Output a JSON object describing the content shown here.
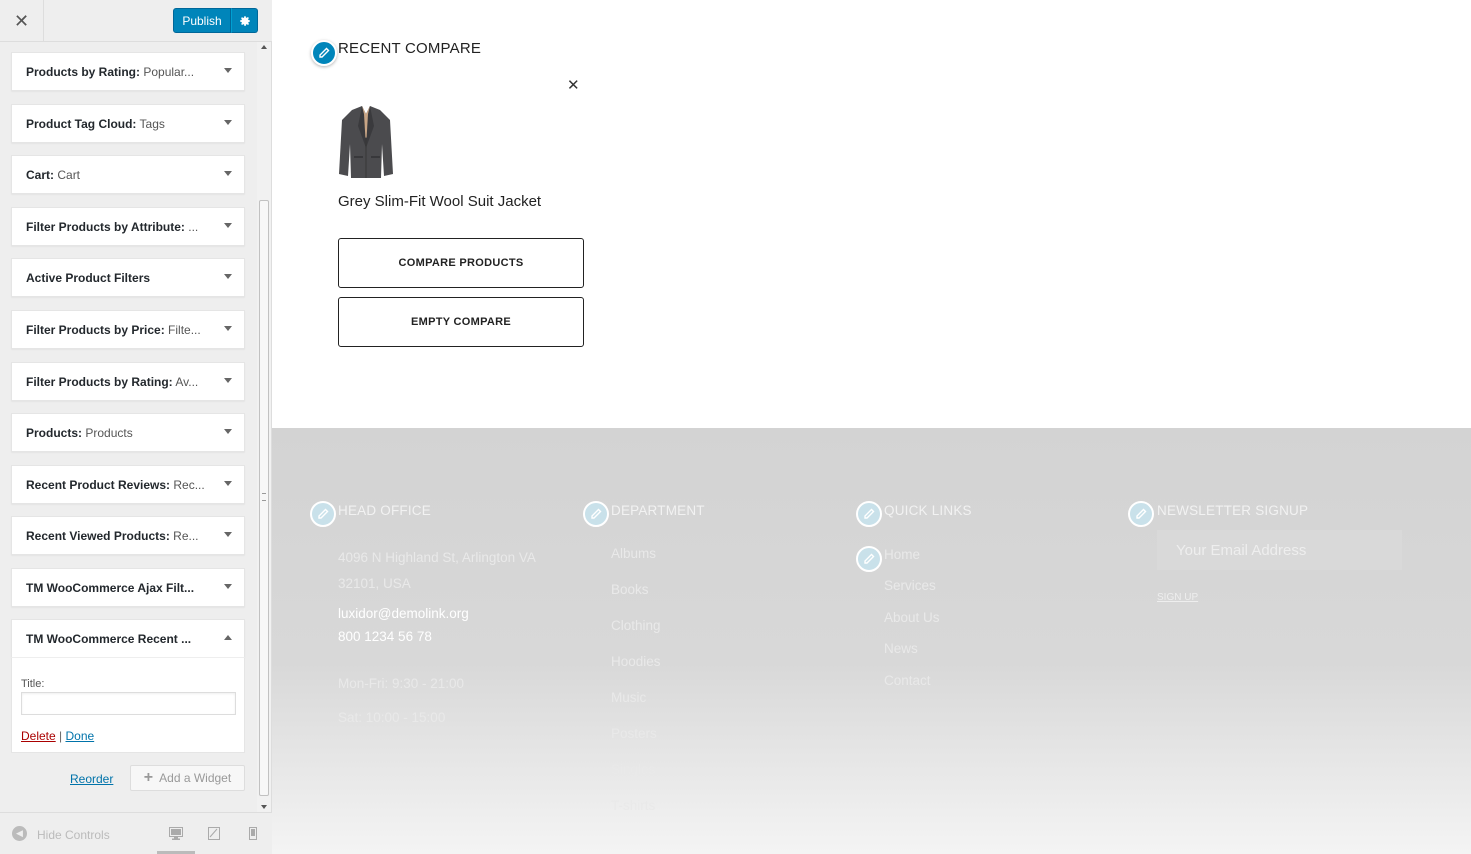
{
  "header": {
    "close_label": "✕",
    "publish_label": "Publish",
    "publish_settings_icon": "gear-icon"
  },
  "widgets": [
    {
      "name": "Products by Rating:",
      "subtitle": " Popular..."
    },
    {
      "name": "Product Tag Cloud:",
      "subtitle": " Tags"
    },
    {
      "name": "Cart:",
      "subtitle": " Cart"
    },
    {
      "name": "Filter Products by Attribute:",
      "subtitle": " ..."
    },
    {
      "name": "Active Product Filters",
      "subtitle": ""
    },
    {
      "name": "Filter Products by Price:",
      "subtitle": " Filte..."
    },
    {
      "name": "Filter Products by Rating:",
      "subtitle": " Av..."
    },
    {
      "name": "Products:",
      "subtitle": " Products"
    },
    {
      "name": "Recent Product Reviews:",
      "subtitle": " Rec..."
    },
    {
      "name": "Recent Viewed Products:",
      "subtitle": " Re..."
    },
    {
      "name": "TM WooCommerce Ajax Filt...",
      "subtitle": ""
    },
    {
      "name": "TM WooCommerce Recent ...",
      "subtitle": ""
    }
  ],
  "open_widget": {
    "title_label": "Title:",
    "title_value": "",
    "delete_label": "Delete",
    "separator": " | ",
    "done_label": "Done"
  },
  "widget_area": {
    "reorder_label": "Reorder",
    "add_widget_label": "Add a Widget"
  },
  "footer_controls": {
    "hide_controls_label": "Hide Controls"
  },
  "preview": {
    "compare": {
      "title": "RECENT COMPARE",
      "product_name": "Grey Slim-Fit Wool Suit Jacket",
      "compare_button": "COMPARE PRODUCTS",
      "empty_button": "EMPTY COMPARE"
    },
    "footer": {
      "head_office": {
        "title": "HEAD OFFICE",
        "address_line1": "4096 N Highland St, Arlington VA",
        "address_line2": "32101, USA",
        "email": "luxidor@demolink.org",
        "phone": "800 1234 56 78",
        "hours1": "Mon-Fri: 9:30 - 21:00",
        "hours2": "Sat: 10:00 - 15:00"
      },
      "department": {
        "title": "DEPARTMENT",
        "items": [
          "Albums",
          "Books",
          "Clothing",
          "Hoodies",
          "Music",
          "Posters",
          "Singles",
          "T-shirts"
        ]
      },
      "quick_links": {
        "title": "QUICK LINKS",
        "items": [
          "Home",
          "Services",
          "About Us",
          "News",
          "Contact"
        ]
      },
      "newsletter": {
        "title": "NEWSLETTER SIGNUP",
        "placeholder": "Your Email Address",
        "signup_label": "SIGN UP"
      }
    }
  },
  "colors": {
    "accent": "#0085ba",
    "link": "#0073aa",
    "delete": "#aa0000",
    "sidebar_bg": "#eeeeee"
  }
}
